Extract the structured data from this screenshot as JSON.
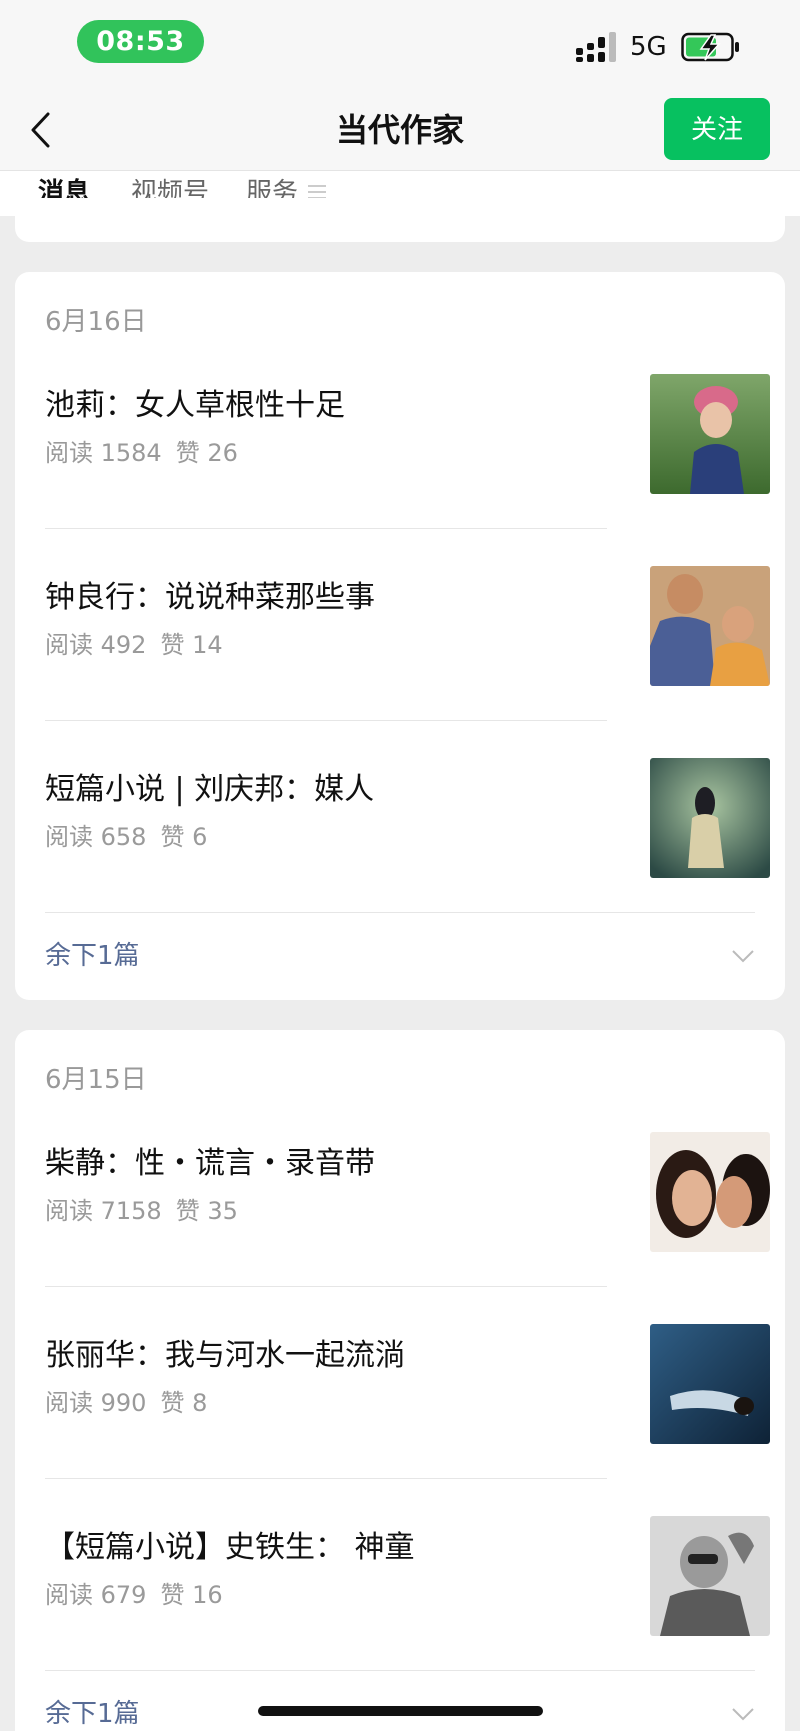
{
  "status_bar": {
    "time": "08:53",
    "network": "5G"
  },
  "nav": {
    "title": "当代作家",
    "follow_label": "关注"
  },
  "tabs": [
    {
      "label": "消息",
      "active": true
    },
    {
      "label": "视频号",
      "active": false
    },
    {
      "label": "服务",
      "active": false
    }
  ],
  "groups": [
    {
      "date": "6月16日",
      "articles": [
        {
          "title": "池莉：女人草根性十足",
          "reads": "阅读 1584",
          "likes": "赞 26"
        },
        {
          "title": "钟良行：说说种菜那些事",
          "reads": "阅读 492",
          "likes": "赞 14"
        },
        {
          "title": "短篇小说 | 刘庆邦：媒人",
          "reads": "阅读 658",
          "likes": "赞 6"
        }
      ],
      "more_label": "余下1篇"
    },
    {
      "date": "6月15日",
      "articles": [
        {
          "title": "柴静：性・谎言・录音带",
          "reads": "阅读 7158",
          "likes": "赞 35"
        },
        {
          "title": "张丽华：我与河水一起流淌",
          "reads": "阅读 990",
          "likes": "赞 8"
        },
        {
          "title": "【短篇小说】史铁生： 神童",
          "reads": "阅读 679",
          "likes": "赞 16"
        }
      ],
      "more_label": "余下1篇"
    }
  ],
  "colors": {
    "accent_green": "#07c160",
    "link_blue": "#576b95",
    "meta_gray": "#9a9a9a"
  }
}
